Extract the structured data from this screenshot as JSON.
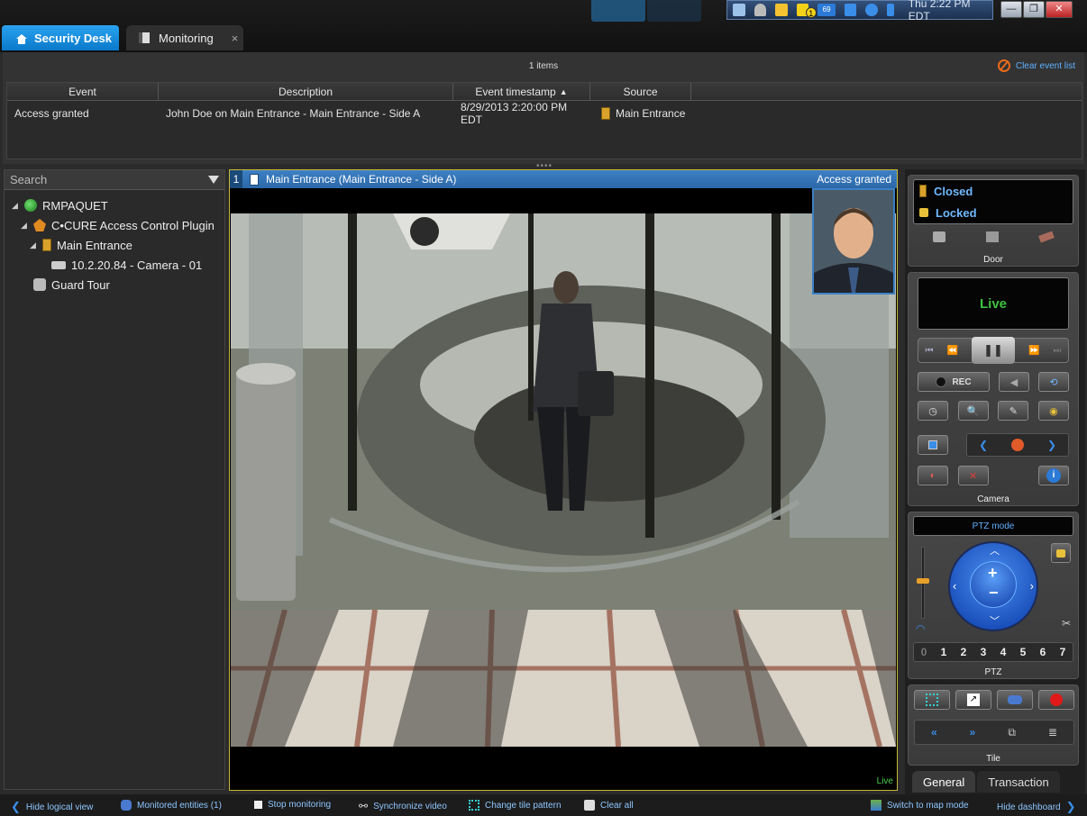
{
  "tabs": {
    "home_label": "Security Desk",
    "monitoring_label": "Monitoring",
    "close_glyph": "×"
  },
  "tray": {
    "time": "Thu 2:22 PM EDT",
    "badge_count": "1",
    "network_count": "69"
  },
  "window_controls": {
    "minimize": "—",
    "maximize": "❐",
    "close": "✕"
  },
  "event_list": {
    "count_label": "1 items",
    "clear_label": "Clear event list",
    "columns": [
      "Event",
      "Description",
      "Event timestamp",
      "Source"
    ],
    "rows": [
      {
        "event": "Access granted",
        "description": "John Doe on Main Entrance - Main Entrance - Side A",
        "timestamp": "8/29/2013 2:20:00 PM EDT",
        "source": "Main Entrance"
      }
    ]
  },
  "logical_view": {
    "search_placeholder": "Search",
    "tree": [
      {
        "label": "RMPAQUET",
        "icon": "globe-icon"
      },
      {
        "label": "C•CURE Access Control Plugin",
        "icon": "plugin-icon"
      },
      {
        "label": "Main Entrance",
        "icon": "door-icon"
      },
      {
        "label": "10.2.20.84 - Camera - 01",
        "icon": "camera-icon"
      },
      {
        "label": "Guard Tour",
        "icon": "guard-tour-icon"
      }
    ]
  },
  "tile": {
    "number": "1",
    "title": "Main Entrance (Main Entrance - Side A)",
    "event": "Access granted",
    "live_label": "Live"
  },
  "dashboard": {
    "door": {
      "state_closed": "Closed",
      "state_locked": "Locked",
      "label": "Door"
    },
    "camera": {
      "live": "Live",
      "rec": "REC",
      "label": "Camera"
    },
    "ptz": {
      "mode": "PTZ mode",
      "label": "PTZ",
      "presets": [
        "0",
        "1",
        "2",
        "3",
        "4",
        "5",
        "6",
        "7"
      ]
    },
    "tile": {
      "label": "Tile"
    },
    "tabs": {
      "general": "General",
      "transaction": "Transaction"
    }
  },
  "bottom_bar": {
    "hide_logical_view": "Hide logical view",
    "monitored_entities": "Monitored entities (1)",
    "stop_monitoring": "Stop monitoring",
    "synchronize_video": "Synchronize video",
    "change_tile_pattern": "Change tile pattern",
    "clear_all": "Clear all",
    "switch_to_map": "Switch to map mode",
    "hide_dashboard": "Hide dashboard"
  },
  "colors": {
    "accent_blue": "#2c68a8",
    "link_blue": "#8ec6ff",
    "tile_border": "#c9b83a",
    "live_green": "#4cd04c",
    "door_text": "#6fb8ff"
  }
}
